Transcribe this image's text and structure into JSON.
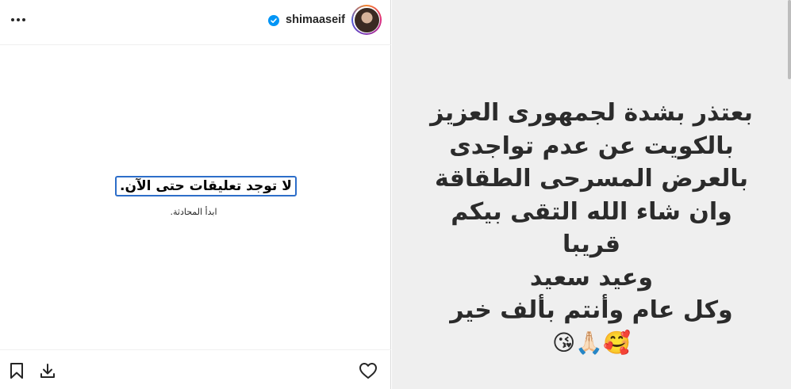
{
  "header": {
    "username": "shimaaseif",
    "more_icon": "more-horizontal-icon",
    "verified_icon": "verified-badge-icon"
  },
  "comments": {
    "empty_title": "لا توجد تعليقات حتى الآن.",
    "empty_subtitle": "ابدأ المحادثة."
  },
  "actions": {
    "save_icon": "bookmark-icon",
    "download_icon": "download-icon",
    "like_icon": "heart-icon"
  },
  "story": {
    "lines": [
      "بعتذر بشدة لجمهورى العزيز",
      "بالكويت عن عدم تواجدى",
      "بالعرض المسرحى الطقاقة",
      "وان شاء الله التقى بيكم",
      "قريبا",
      "وعيد سعيد",
      "وكل عام وأنتم بألف خير"
    ],
    "emojis": "🥰🙏🏻😘"
  },
  "colors": {
    "accent": "#0095f6",
    "focus_border": "#2d6ec9",
    "story_bg": "#efefef"
  }
}
